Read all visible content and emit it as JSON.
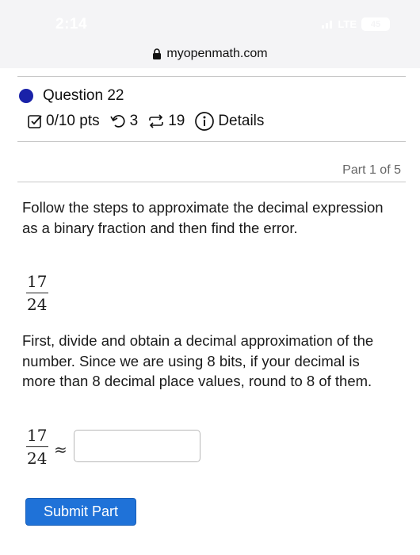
{
  "status_bar": {
    "time": "2:14",
    "network": "LTE",
    "battery": "45"
  },
  "browser": {
    "url": "myopenmath.com"
  },
  "question": {
    "title": "Question 22",
    "points": "0/10 pts",
    "retries": "3",
    "attempts": "19",
    "details_label": "Details"
  },
  "part_label": "Part 1 of 5",
  "instructions": "Follow the steps to approximate the decimal expression as a binary fraction and then find the error.",
  "fraction": {
    "numerator": "17",
    "denominator": "24"
  },
  "step_text": "First, divide and obtain a decimal approximation of the number. Since we are using 8 bits, if your decimal is more than 8 decimal place values, round to 8 of them.",
  "answer": {
    "fraction_numerator": "17",
    "fraction_denominator": "24",
    "approx_symbol": "≈",
    "value": ""
  },
  "submit_label": "Submit Part",
  "colors": {
    "accent": "#1f72d8",
    "question_dot": "#1a22a8"
  }
}
